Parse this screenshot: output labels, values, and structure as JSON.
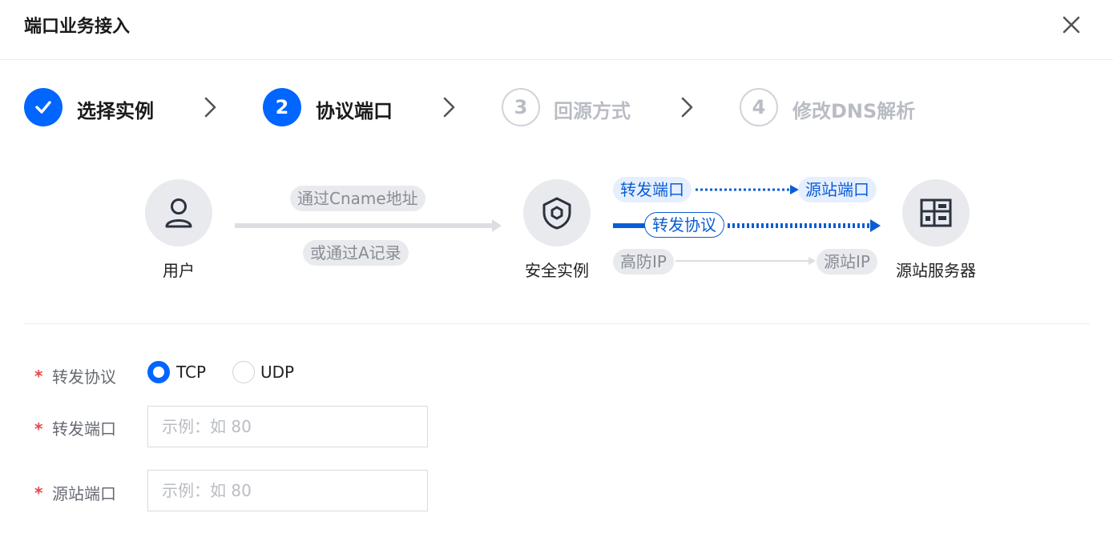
{
  "dialog": {
    "title": "端口业务接入"
  },
  "steps": [
    {
      "number": "1",
      "label": "选择实例",
      "state": "done"
    },
    {
      "number": "2",
      "label": "协议端口",
      "state": "active"
    },
    {
      "number": "3",
      "label": "回源方式",
      "state": "pending"
    },
    {
      "number": "4",
      "label": "修改DNS解析",
      "state": "pending"
    }
  ],
  "diagram": {
    "user_label": "用户",
    "via_cname": "通过Cname地址",
    "via_a_record": "或通过A记录",
    "instance_label": "安全实例",
    "forward_port": "转发端口",
    "origin_port": "源站端口",
    "forward_protocol": "转发协议",
    "high_defense_ip": "高防IP",
    "origin_ip": "源站IP",
    "server_label": "源站服务器"
  },
  "form": {
    "protocol": {
      "label": "转发协议",
      "options": [
        "TCP",
        "UDP"
      ],
      "selected": "TCP"
    },
    "forward_port": {
      "label": "转发端口",
      "placeholder": "示例：如 80",
      "value": ""
    },
    "origin_port": {
      "label": "源站端口",
      "placeholder": "示例：如 80",
      "value": ""
    }
  },
  "colors": {
    "primary": "#0066ff",
    "required": "#e5484d",
    "muted": "#b9bcc4"
  }
}
